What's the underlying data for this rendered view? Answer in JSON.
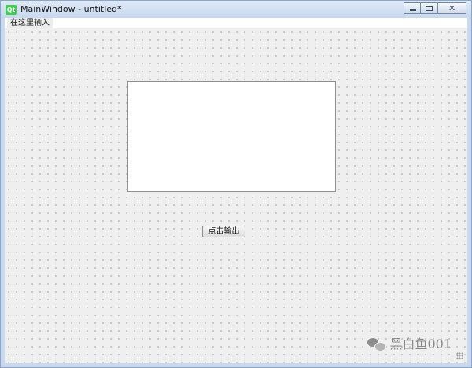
{
  "window": {
    "title": "MainWindow - untitled*",
    "logo_text": "Qt"
  },
  "menubar": {
    "items": [
      {
        "label": "在这里输入"
      }
    ]
  },
  "button": {
    "label": "点击输出"
  },
  "text_display": {
    "value": ""
  },
  "watermark": {
    "text": "黑白鱼001"
  },
  "colors": {
    "titlebar": "#c7d8ee",
    "canvas": "#efefef",
    "qt_logo": "#41cd52"
  }
}
